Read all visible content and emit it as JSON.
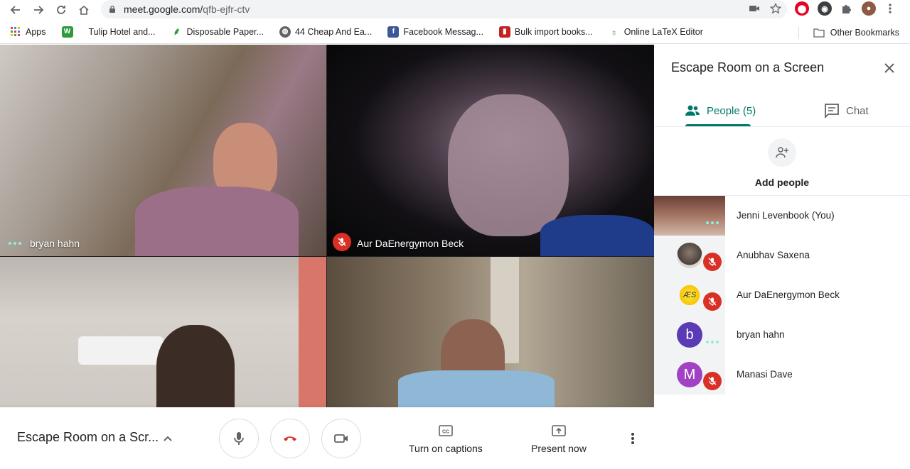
{
  "browser": {
    "url_domain": "meet.google.com/",
    "url_path": "qfb-ejfr-ctv",
    "bookmarks": [
      {
        "label": "Apps",
        "icon": "apps-grid-icon"
      },
      {
        "label": "",
        "icon": "w-icon"
      },
      {
        "label": "Tulip Hotel and...",
        "icon": ""
      },
      {
        "label": "Disposable Paper...",
        "icon": "leaf-icon"
      },
      {
        "label": "44 Cheap And Ea...",
        "icon": "globe-icon"
      },
      {
        "label": "Facebook Messag...",
        "icon": "facebook-icon"
      },
      {
        "label": "Bulk import books...",
        "icon": "book-icon"
      },
      {
        "label": "Online LaTeX Editor",
        "icon": "overleaf-icon"
      }
    ],
    "other_bookmarks": "Other Bookmarks"
  },
  "video": {
    "tiles": [
      {
        "name": "bryan hahn",
        "status": "speaking"
      },
      {
        "name": "Aur DaEnergymon Beck",
        "status": "muted"
      },
      {
        "name": "",
        "status": ""
      },
      {
        "name": "",
        "status": ""
      }
    ]
  },
  "controls": {
    "meeting_name": "Escape Room on a Scr...",
    "captions_label": "Turn on captions",
    "present_label": "Present now"
  },
  "panel": {
    "title": "Escape Room on a Screen",
    "tab_people": "People (5)",
    "tab_chat": "Chat",
    "add_people": "Add people",
    "participants": [
      {
        "name": "Jenni Levenbook (You)",
        "avatar": "",
        "muted": false,
        "speaking": true
      },
      {
        "name": "Anubhav Saxena",
        "avatar": "",
        "muted": true,
        "speaking": false
      },
      {
        "name": "Aur DaEnergymon Beck",
        "avatar": "ÆS",
        "muted": true,
        "speaking": false
      },
      {
        "name": "bryan hahn",
        "avatar": "b",
        "muted": false,
        "speaking": true
      },
      {
        "name": "Manasi Dave",
        "avatar": "M",
        "muted": true,
        "speaking": false
      }
    ]
  },
  "colors": {
    "accent": "#00796b",
    "mute_red": "#d93025",
    "avatar_b": "#5b3bb5",
    "avatar_m": "#a142c4"
  }
}
